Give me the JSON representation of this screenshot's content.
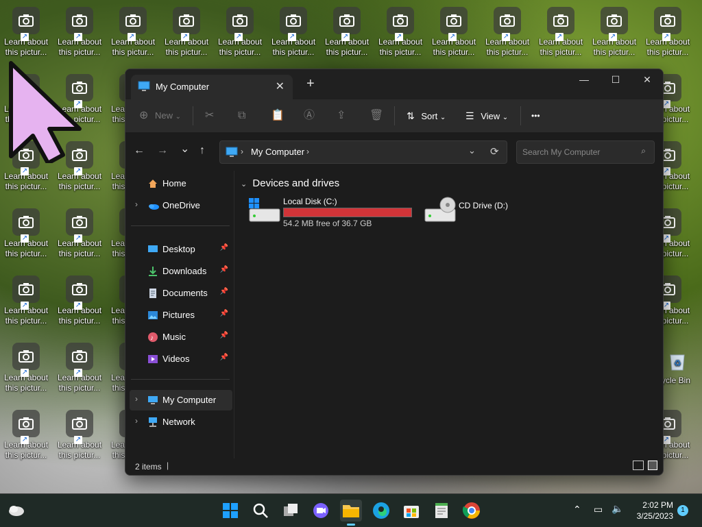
{
  "desktop": {
    "shortcut_label_line1": "Learn about",
    "shortcut_label_line2": "this pictur...",
    "recycle_bin_label": "ycle Bin",
    "cursor_label_line1": "Learn about",
    "cursor_label_line2": "this pictur..."
  },
  "window": {
    "tab_title": "My Computer",
    "tab_close": "✕",
    "new_tab": "+",
    "minimize": "—",
    "maximize": "☐",
    "close": "✕"
  },
  "toolbar": {
    "new_label": "New",
    "sort_label": "Sort",
    "view_label": "View",
    "more_label": "•••"
  },
  "nav": {
    "back": "←",
    "forward": "→",
    "recent": "⌄",
    "up": "↑",
    "address_path": "My Computer",
    "refresh": "⟳",
    "search_placeholder": "Search My Computer"
  },
  "sidebar": {
    "items": [
      {
        "label": "Home"
      },
      {
        "label": "OneDrive"
      },
      {
        "label": "Desktop"
      },
      {
        "label": "Downloads"
      },
      {
        "label": "Documents"
      },
      {
        "label": "Pictures"
      },
      {
        "label": "Music"
      },
      {
        "label": "Videos"
      },
      {
        "label": "My Computer"
      },
      {
        "label": "Network"
      }
    ]
  },
  "content": {
    "group_title": "Devices and drives",
    "drives": [
      {
        "name": "Local Disk (C:)",
        "free_text": "54.2 MB free of 36.7 GB",
        "used_fraction": 0.9986,
        "bar_color": "#d13438"
      },
      {
        "name": "CD Drive (D:)"
      }
    ]
  },
  "status": {
    "items_count": "2 items"
  },
  "taskbar": {
    "time": "2:02 PM",
    "date": "3/25/2023",
    "notif_count": "1",
    "tray_chevron": "^"
  }
}
